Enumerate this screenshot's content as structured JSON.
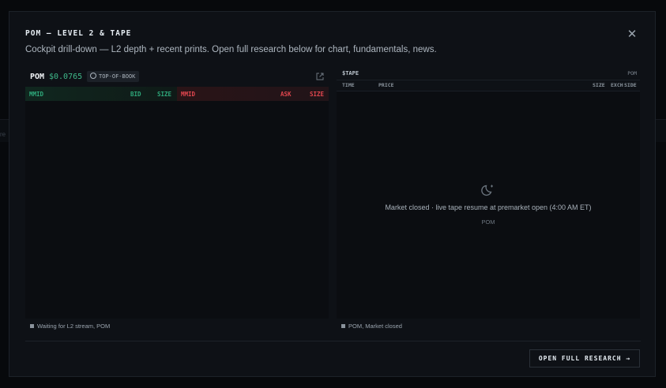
{
  "backdrop": {
    "partial_text": "re"
  },
  "modal": {
    "title": "POM — LEVEL 2 & TAPE",
    "subtitle": "Cockpit drill-down — L2 depth + recent prints. Open full research below for chart, fundamentals, news.",
    "close_icon": "close-icon"
  },
  "l2": {
    "symbol": "POM",
    "price": "$0.0765",
    "badge": "TOP-OF-BOOK",
    "external_icon": "external-link-icon",
    "bid_columns": [
      "MMID",
      "BID",
      "SIZE"
    ],
    "ask_columns": [
      "MMID",
      "ASK",
      "SIZE"
    ],
    "status": "Waiting for L2 stream, POM",
    "colors": {
      "bid": "#2ea87a",
      "ask": "#e0464e"
    }
  },
  "tape": {
    "title": "$TAPE",
    "symbol": "POM",
    "columns": [
      "TIME",
      "PRICE",
      "SIZE",
      "EXCH",
      "SIDE"
    ],
    "empty_icon": "moon-icon",
    "empty_message": "Market closed · live tape resume at premarket open (4:00 AM ET)",
    "empty_symbol": "POM",
    "status": "POM, Market closed"
  },
  "footer": {
    "research_button": "OPEN FULL RESEARCH →"
  }
}
